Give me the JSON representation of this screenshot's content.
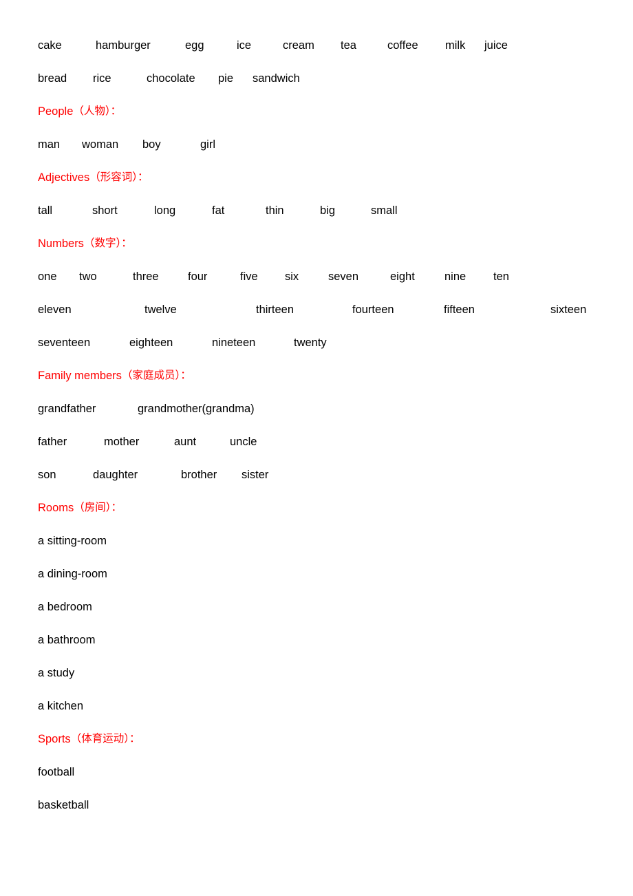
{
  "document": {
    "type": "vocabulary-word-list",
    "language_pair": "English-Chinese",
    "heading_color": "#ff0000",
    "body_color": "#000000",
    "background_color": "#ffffff"
  },
  "sections": [
    {
      "id": "food-continued",
      "heading": null,
      "rows": [
        {
          "words": [
            "cake",
            "hamburger",
            "egg",
            "ice",
            "cream",
            "tea",
            "coffee",
            "milk",
            "juice"
          ],
          "widths": [
            "t-84",
            "t-130",
            "t-75",
            "t-67",
            "t-84",
            "t-68",
            "t-84",
            "t-57",
            "t-auto"
          ]
        },
        {
          "words": [
            "bread",
            "rice",
            "chocolate",
            "pie",
            "sandwich"
          ],
          "widths": [
            "t-80",
            "t-78",
            "t-104",
            "t-50",
            "t-auto"
          ]
        }
      ]
    },
    {
      "id": "people",
      "heading": {
        "en": "People",
        "cn": "（人物）："
      },
      "rows": [
        {
          "words": [
            "man",
            "woman",
            "boy",
            "girl"
          ],
          "widths": [
            "t-64",
            "t-88",
            "t-84",
            "t-auto"
          ]
        }
      ]
    },
    {
      "id": "adjectives",
      "heading": {
        "en": "Adjectives",
        "cn": "（形容词）："
      },
      "rows": [
        {
          "words": [
            "tall",
            "short",
            "long",
            "fat",
            "thin",
            "big",
            "small"
          ],
          "widths": [
            "t-79",
            "t-90",
            "t-84",
            "t-78",
            "t-79",
            "t-74",
            "t-auto"
          ]
        }
      ]
    },
    {
      "id": "numbers",
      "heading": {
        "en": "Numbers",
        "cn": "（数字）："
      },
      "rows": [
        {
          "words": [
            "one",
            "two",
            "three",
            "four",
            "five",
            "six",
            "seven",
            "eight",
            "nine",
            "ten"
          ],
          "widths": [
            "t-60",
            "t-78",
            "t-80",
            "t-76",
            "t-65",
            "t-63",
            "t-90",
            "t-79",
            "t-71",
            "t-auto"
          ]
        },
        {
          "words": [
            "eleven",
            "twelve",
            "thirteen",
            "fourteen",
            "fifteen",
            "sixteen"
          ],
          "widths": [
            "t-155",
            "t-162",
            "t-140",
            "t-133",
            "t-155",
            "t-auto"
          ]
        },
        {
          "words": [
            "seventeen",
            "eighteen",
            "nineteen",
            "twenty"
          ],
          "widths": [
            "t-133",
            "t-120",
            "t-119",
            "t-auto"
          ]
        }
      ]
    },
    {
      "id": "family-members",
      "heading": {
        "en": "Family members",
        "cn": "（家庭成员）："
      },
      "rows": [
        {
          "words": [
            "grandfather",
            "grandmother(grandma)"
          ],
          "widths": [
            "t-145",
            "t-auto"
          ]
        },
        {
          "words": [
            "father",
            "mother",
            "aunt",
            "uncle"
          ],
          "widths": [
            "t-96",
            "t-102",
            "t-81",
            "t-auto"
          ]
        },
        {
          "words": [
            "son",
            "daughter",
            "brother",
            "sister"
          ],
          "widths": [
            "t-80",
            "t-128",
            "t-88",
            "t-auto"
          ]
        }
      ]
    },
    {
      "id": "rooms",
      "heading": {
        "en": "Rooms",
        "cn": "（房间）："
      },
      "rows": [
        {
          "words": [
            "a sitting-room"
          ],
          "widths": [
            "t-auto"
          ]
        },
        {
          "words": [
            "a dining-room"
          ],
          "widths": [
            "t-auto"
          ]
        },
        {
          "words": [
            "a bedroom"
          ],
          "widths": [
            "t-auto"
          ]
        },
        {
          "words": [
            "a bathroom"
          ],
          "widths": [
            "t-auto"
          ]
        },
        {
          "words": [
            "a study"
          ],
          "widths": [
            "t-auto"
          ]
        },
        {
          "words": [
            "a kitchen"
          ],
          "widths": [
            "t-auto"
          ]
        }
      ]
    },
    {
      "id": "sports",
      "heading": {
        "en": "Sports",
        "cn": "（体育运动）："
      },
      "rows": [
        {
          "words": [
            "football"
          ],
          "widths": [
            "t-auto"
          ]
        },
        {
          "words": [
            "basketball"
          ],
          "widths": [
            "t-auto"
          ]
        }
      ]
    }
  ]
}
